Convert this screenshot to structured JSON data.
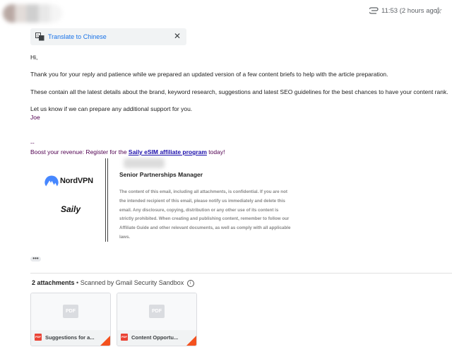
{
  "header": {
    "time": "11:53 (2 hours ago)"
  },
  "translate": {
    "label": "Translate to Chinese"
  },
  "email": {
    "greeting": "Hi,",
    "para1": "Thank you for your reply and patience while we prepared an updated version of a few content briefs to help with the article preparation.",
    "para2": "These contain all the latest details about the brand, keyword research, suggestions and latest SEO guidelines for the best chances to have your content rank.",
    "para3": "Let us know if we can prepare any additional support for you.",
    "signoff": "Joe",
    "separator": "--",
    "promo_prefix": "Boost your revenue: Register for the ",
    "promo_link": "Saily eSIM affiliate program",
    "promo_suffix": " today!"
  },
  "signature": {
    "title": "Senior Partnerships Manager",
    "logo1": "NordVPN",
    "logo2": "Saily",
    "disclaimer_lines": [
      "The content of this email, including all attachments, is confidential. If you are not",
      "the intended recipient of this email, please notify us immediately and delete this",
      "email. Any disclosure, copying, distribution or any other use of its content is",
      "strictly prohibited. When creating and publishing content, remember to follow our",
      "Affiliate Guide and other relevant documents, as well as comply with all applicable",
      "laws."
    ]
  },
  "ellipsis": "•••",
  "attachments": {
    "count_label": "2 attachments",
    "scan_label": "• Scanned by Gmail Security Sandbox",
    "info_glyph": "i",
    "preview_label": "PDF",
    "badge_label": "PDF",
    "files": [
      {
        "name": "Suggestions for a..."
      },
      {
        "name": "Content Opportu..."
      }
    ]
  },
  "colors": {
    "link_blue": "#1a73e8",
    "signature_purple": "#500050",
    "pdf_red": "#ea4335",
    "nord_blue": "#4687ff"
  }
}
